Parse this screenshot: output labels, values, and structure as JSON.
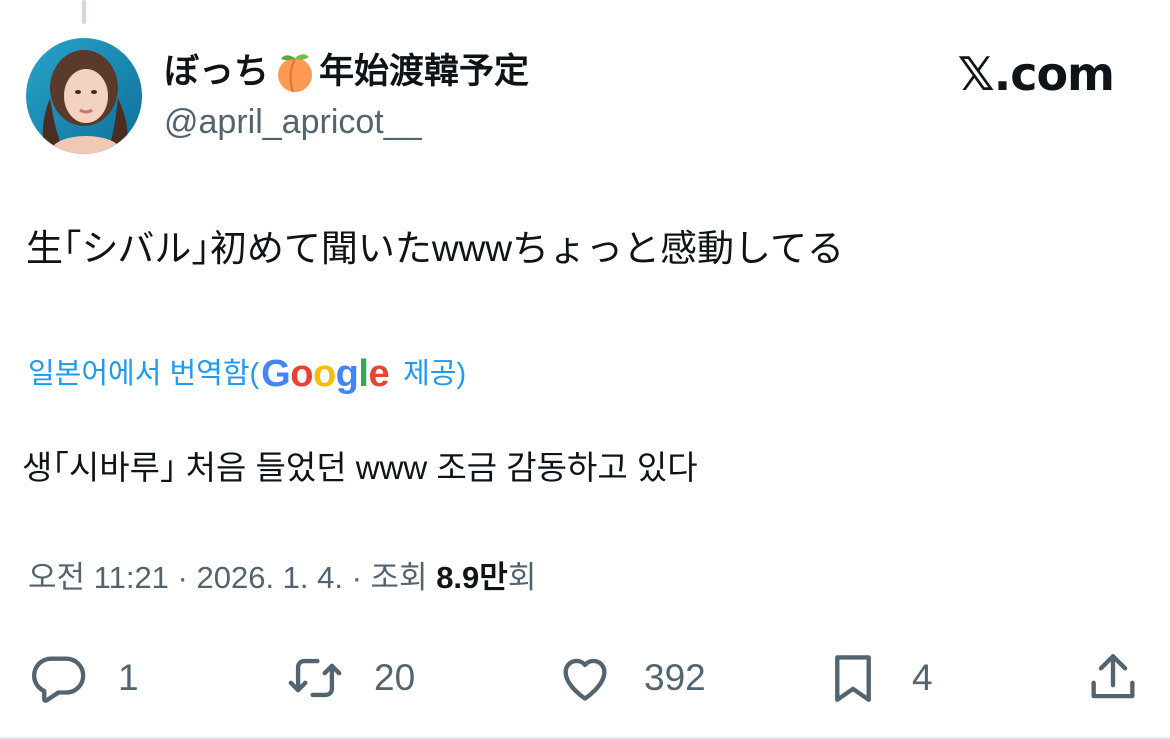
{
  "author": {
    "display_name": "ぼっち",
    "display_name_suffix": "年始渡韓予定",
    "emoji_icon": "peach-emoji",
    "handle": "@april_apricot__"
  },
  "brand": "𝕏.com",
  "tweet": {
    "text": "生｢シバル｣初めて聞いたwwwちょっと感動してる"
  },
  "translation": {
    "label": "일본어에서 번역함(",
    "google_letters": [
      "G",
      "o",
      "o",
      "g",
      "l",
      "e"
    ],
    "google_colors": [
      "#4285F4",
      "#EA4335",
      "#FBBC05",
      "#4285F4",
      "#34A853",
      "#EA4335"
    ],
    "suffix": " 제공)",
    "text": "생｢시바루｣ 처음 들었던 www 조금 감동하고 있다"
  },
  "meta": {
    "time": "오전 11:21 · 2026. 1. 4. · 조회 ",
    "views": "8.9만",
    "views_suffix": "회"
  },
  "actions": {
    "reply_count": "1",
    "retweet_count": "20",
    "like_count": "392",
    "bookmark_count": "4"
  },
  "colors": {
    "link_blue": "#1d9bf0",
    "secondary_text": "#536471",
    "primary_text": "#0f1419"
  }
}
